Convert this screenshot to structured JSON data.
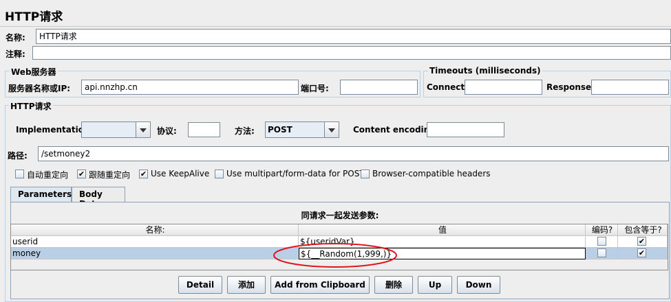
{
  "title": "HTTP请求",
  "name_label": "名称:",
  "name_value": "HTTP请求",
  "comment_label": "注释:",
  "comment_value": "",
  "web_server": {
    "legend": "Web服务器",
    "server_label": "服务器名称或IP:",
    "server_value": "api.nnzhp.cn",
    "port_label": "端口号:",
    "port_value": ""
  },
  "timeouts": {
    "legend": "Timeouts (milliseconds)",
    "connect_label": "Connect:",
    "connect_value": "",
    "response_label": "Response:",
    "response_value": ""
  },
  "http_request": {
    "legend": "HTTP请求",
    "implementation_label": "Implementation:",
    "implementation_value": "",
    "protocol_label": "协议:",
    "protocol_value": "",
    "method_label": "方法:",
    "method_value": "POST",
    "encoding_label": "Content encoding:",
    "encoding_value": "",
    "path_label": "路径:",
    "path_value": "/setmoney2"
  },
  "options": [
    {
      "label": "自动重定向",
      "checked": false
    },
    {
      "label": "跟随重定向",
      "checked": true
    },
    {
      "label": "Use KeepAlive",
      "checked": true
    },
    {
      "label": "Use multipart/form-data for POST",
      "checked": false
    },
    {
      "label": "Browser-compatible headers",
      "checked": false
    }
  ],
  "tabs": [
    {
      "label": "Parameters",
      "active": true
    },
    {
      "label": "Body Data",
      "active": false
    }
  ],
  "params_title": "同请求一起发送参数:",
  "table": {
    "headers": [
      "名称:",
      "值",
      "编码?",
      "包含等于?"
    ],
    "rows": [
      {
        "name": "userid",
        "value": "${useridVar}",
        "encode": false,
        "include_equals": true,
        "selected": false
      },
      {
        "name": "money",
        "value": "${__Random(1,999,)}",
        "encode": false,
        "include_equals": true,
        "selected": true
      }
    ]
  },
  "buttons": [
    "Detail",
    "添加",
    "Add from Clipboard",
    "删除",
    "Up",
    "Down"
  ],
  "colors": {
    "annotation": "#e0141e",
    "selection": "#b8cfe5",
    "tab_active": "#dfe8f1"
  }
}
